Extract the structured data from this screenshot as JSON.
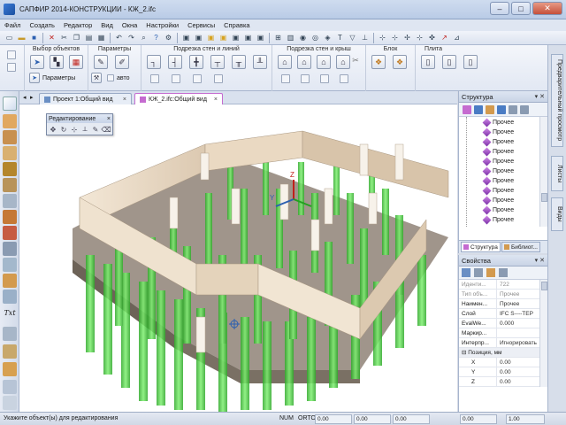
{
  "window": {
    "title": "САПФИР 2014-КОНСТРУКЦИИ - КЖ_2.ifc",
    "controls": [
      "–",
      "□",
      "✕"
    ]
  },
  "menu": [
    "Файл",
    "Создать",
    "Редактор",
    "Вид",
    "Окна",
    "Настройки",
    "Сервисы",
    "Справка"
  ],
  "ribbon": {
    "groups": {
      "select": "Выбор объектов",
      "params": "Параметры",
      "walls_lines": "Подрезка стен и линий",
      "walls_roofs": "Подрезка стен и крыш",
      "block": "Блок",
      "slab": "Плита"
    },
    "params_button": "Параметры",
    "auto_label": "авто"
  },
  "tabs": [
    {
      "label": "Проект 1:Общий вид",
      "close": "×"
    },
    {
      "label": "КЖ_2.ifc:Общий вид",
      "close": "×"
    }
  ],
  "edit_palette": {
    "title": "Редактирование",
    "close": "×"
  },
  "structure_panel": {
    "title": "Структура",
    "buttons": "▾ ✕",
    "items": [
      "Прочее",
      "Прочее",
      "Прочее",
      "Прочее",
      "Прочее",
      "Прочее",
      "Прочее",
      "Прочее",
      "Прочее",
      "Прочее",
      "Прочее",
      "Прочее"
    ],
    "bottom_tabs": [
      "Структура",
      "Библиот..."
    ]
  },
  "properties_panel": {
    "title": "Свойства",
    "buttons": "▾ ✕",
    "rows": [
      {
        "key": "Иденти...",
        "value": "722",
        "grey": true
      },
      {
        "key": "Тип объ...",
        "value": "Прочее",
        "grey": true
      },
      {
        "key": "Наимен...",
        "value": "Прочее",
        "grey": false
      },
      {
        "key": "Слой",
        "value": "IFC S----TEP",
        "grey": false
      },
      {
        "key": "EvalWe...",
        "value": "0.000",
        "grey": false
      },
      {
        "key": "Маркир...",
        "value": "",
        "grey": false
      },
      {
        "key": "Интерпр...",
        "value": "Игнорировать",
        "grey": false
      },
      {
        "key": "⊟ Позиция, мм",
        "value": "",
        "grey": false,
        "section": true
      },
      {
        "key": "X",
        "value": "0.00",
        "grey": false,
        "indent": true
      },
      {
        "key": "Y",
        "value": "0.00",
        "grey": false,
        "indent": true
      },
      {
        "key": "Z",
        "value": "0.00",
        "grey": false,
        "indent": true
      }
    ]
  },
  "side_tabs": [
    "Предварительный просмотр",
    "Листы",
    "Виды"
  ],
  "status": {
    "message": "Укажите объект(ы) для редактирования",
    "num": "NUM",
    "orto": "ORTO",
    "fields": [
      "0.00",
      "0.00",
      "0.00",
      "0.00",
      "1.00"
    ]
  },
  "colors": {
    "piles": "#4fd34a",
    "walls": "#eadcc8",
    "slab": "#8a7d70",
    "accent": "#c56bd0"
  }
}
